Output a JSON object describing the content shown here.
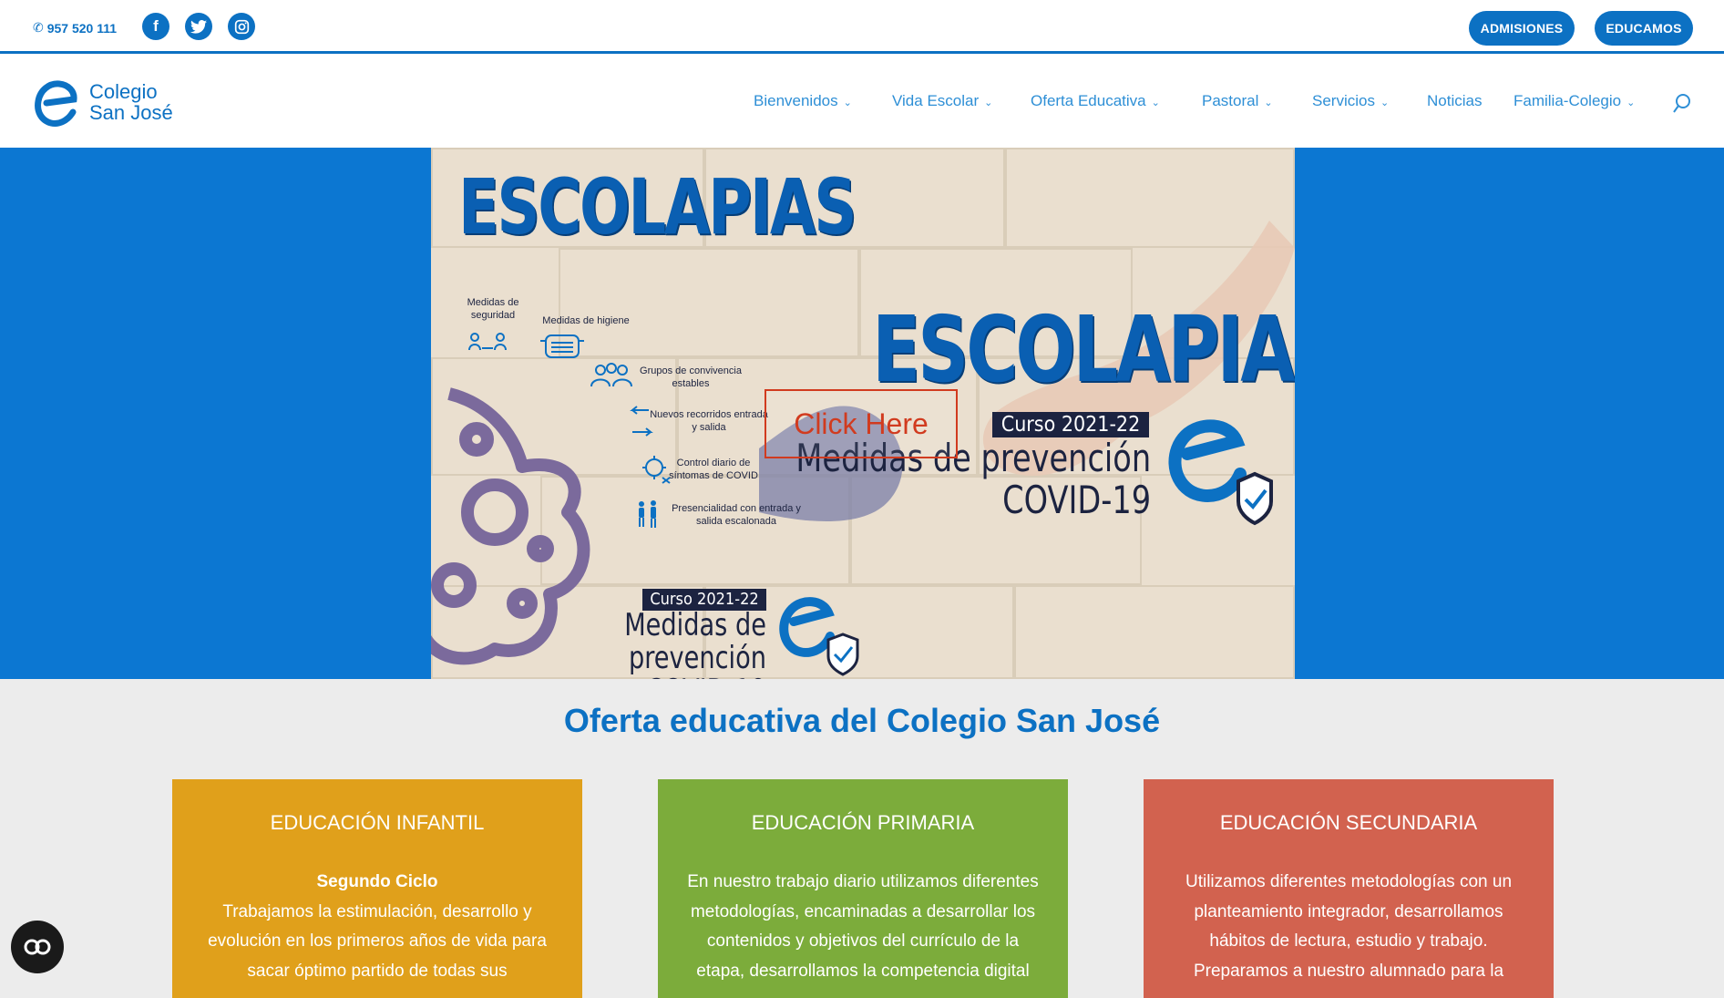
{
  "topbar": {
    "phone": "957 520 111",
    "social": [
      {
        "name": "facebook-icon",
        "glyph": "f"
      },
      {
        "name": "twitter-icon",
        "glyph": "t"
      },
      {
        "name": "instagram-icon",
        "glyph": "◎"
      }
    ],
    "buttons": [
      "ADMISIONES",
      "EDUCAMOS"
    ]
  },
  "logo": {
    "line1": "Colegio",
    "line2": "San José"
  },
  "nav": [
    {
      "label": "Bienvenidos",
      "dropdown": true
    },
    {
      "label": "Vida Escolar",
      "dropdown": true
    },
    {
      "label": "Oferta Educativa",
      "dropdown": true
    },
    {
      "label": "Pastoral",
      "dropdown": true
    },
    {
      "label": "Servicios",
      "dropdown": true
    },
    {
      "label": "Noticias",
      "dropdown": false
    },
    {
      "label": "Familia-Colegio",
      "dropdown": true
    }
  ],
  "banner": {
    "title": "ESCOLAPIAS",
    "curso": "Curso 2021-22",
    "medidas_line1": "Medidas de prevención",
    "medidas_line2": "COVID-19",
    "measures": [
      "Medidas de seguridad",
      "Medidas de higiene",
      "Grupos de convivencia estables",
      "Nuevos recorridos entrada y salida",
      "Control diario de síntomas de COVID",
      "Presencialidad con entrada y salida escalonada"
    ],
    "click_here": "Click Here"
  },
  "section": {
    "title": "Oferta educativa del Colegio San José",
    "cards": [
      {
        "title": "EDUCACIÓN INFANTIL",
        "subtitle": "Segundo Ciclo",
        "text": "Trabajamos la estimulación, desarrollo y evolución en los primeros años de vida para sacar óptimo partido de todas sus",
        "color": "#e0a01b"
      },
      {
        "title": "EDUCACIÓN PRIMARIA",
        "subtitle": "",
        "text": "En nuestro trabajo diario utilizamos diferentes metodologías, encaminadas a desarrollar los contenidos y objetivos del currículo de la etapa, desarrollamos la competencia digital",
        "color": "#7cac3b"
      },
      {
        "title": "EDUCACIÓN SECUNDARIA",
        "subtitle": "",
        "text": "Utilizamos diferentes metodologías con un planteamiento integrador, desarrollamos hábitos de lectura, estudio y trabajo. Preparamos a nuestro alumnado para la",
        "color": "#d2624f"
      }
    ]
  },
  "colors": {
    "brand": "#0c71c3",
    "hero_bg": "#0c77d2"
  }
}
